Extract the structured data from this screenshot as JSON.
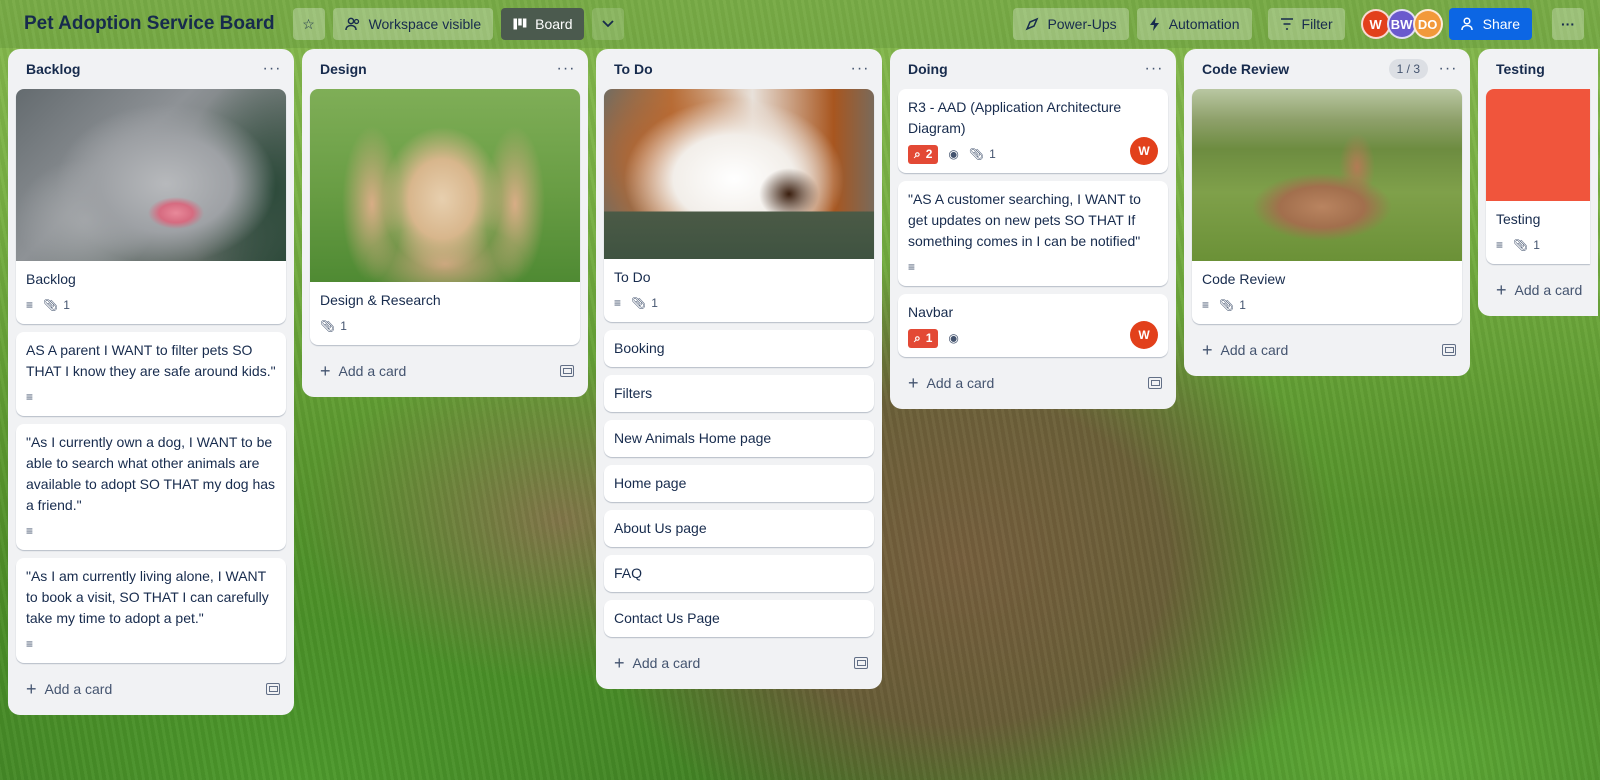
{
  "board": {
    "title": "Pet Adoption Service Board",
    "visibility_label": "Workspace visible",
    "view_label": "Board",
    "powerups_label": "Power-Ups",
    "automation_label": "Automation",
    "filter_label": "Filter",
    "share_label": "Share",
    "members": [
      {
        "initials": "W",
        "color": "#e2401b"
      },
      {
        "initials": "BW",
        "color": "#6a5acd"
      },
      {
        "initials": "DO",
        "color": "#f2993a"
      }
    ]
  },
  "icons": {
    "star": "star-icon",
    "people": "people-icon",
    "board": "board-icon",
    "chevron": "chevron-down-icon",
    "rocket": "rocket-icon",
    "bolt": "bolt-icon",
    "filter": "filter-icon",
    "more": "more-icon",
    "description": "description-icon",
    "attachment": "paperclip-icon",
    "watch": "eye-icon",
    "comment": "comment-icon",
    "template": "card-template-icon"
  },
  "add_card_label": "Add a card",
  "lists": {
    "backlog": {
      "title": "Backlog",
      "cards": [
        {
          "title": "Backlog",
          "attachments": "1"
        },
        {
          "title": "AS A parent I WANT to filter pets SO THAT I know they are safe around kids.\""
        },
        {
          "title": "\"As I currently own a dog, I WANT to be able to search what other animals are available to adopt SO THAT my dog has a friend.\""
        },
        {
          "title": "\"As I am currently living alone, I WANT to book a visit, SO THAT I can carefully take my time to adopt a pet.\""
        }
      ]
    },
    "design": {
      "title": "Design",
      "cards": [
        {
          "title": "Design & Research",
          "attachments": "1"
        }
      ]
    },
    "todo": {
      "title": "To Do",
      "cards": [
        {
          "title": "To Do",
          "attachments": "1"
        },
        {
          "title": "Booking"
        },
        {
          "title": "Filters"
        },
        {
          "title": "New Animals Home page"
        },
        {
          "title": "Home page"
        },
        {
          "title": "About Us page"
        },
        {
          "title": "FAQ"
        },
        {
          "title": "Contact Us Page"
        }
      ]
    },
    "doing": {
      "title": "Doing",
      "cards": [
        {
          "title": "R3 - AAD (Application Architecture Diagram)",
          "comments": "2",
          "attachments": "1",
          "member": "W"
        },
        {
          "title": "\"AS A customer searching, I WANT to get updates on new pets SO THAT If something comes in I can be notified\""
        },
        {
          "title": "Navbar",
          "comments": "1",
          "member": "W"
        }
      ]
    },
    "code_review": {
      "title": "Code Review",
      "count": "1 / 3",
      "cards": [
        {
          "title": "Code Review",
          "attachments": "1"
        }
      ]
    },
    "testing": {
      "title": "Testing",
      "cards": [
        {
          "title": "Testing",
          "attachments": "1"
        }
      ]
    }
  }
}
